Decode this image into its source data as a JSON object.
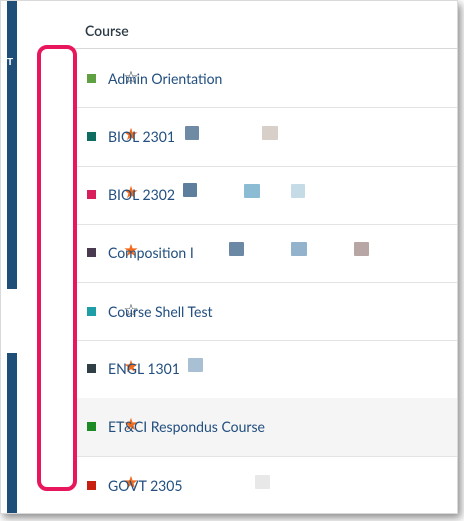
{
  "header": {
    "label": "Course"
  },
  "rows": [
    {
      "name": "Admin Orientation",
      "favorite": false,
      "color": "#5fa043"
    },
    {
      "name": "BIOL 2301",
      "favorite": true,
      "color": "#0e6d5e"
    },
    {
      "name": "BIOL 2302",
      "favorite": true,
      "color": "#d81e5b"
    },
    {
      "name": "Composition I",
      "favorite": true,
      "color": "#4a3a4f"
    },
    {
      "name": "Course Shell Test",
      "favorite": false,
      "color": "#1e9ea5"
    },
    {
      "name": "ENGL 1301",
      "favorite": true,
      "color": "#2f3f45"
    },
    {
      "name": "ET&CI Respondus Course",
      "favorite": true,
      "color": "#1c8a25"
    },
    {
      "name": "GOVT 2305",
      "favorite": true,
      "color": "#c8200f"
    }
  ],
  "icons": {
    "star_filled": "star-filled-icon",
    "star_outline": "star-outline-icon"
  },
  "colors": {
    "star_on": "#f26a1b",
    "highlight": "#e8175d",
    "sidebar": "#1f4e79",
    "link": "#224f7f"
  }
}
